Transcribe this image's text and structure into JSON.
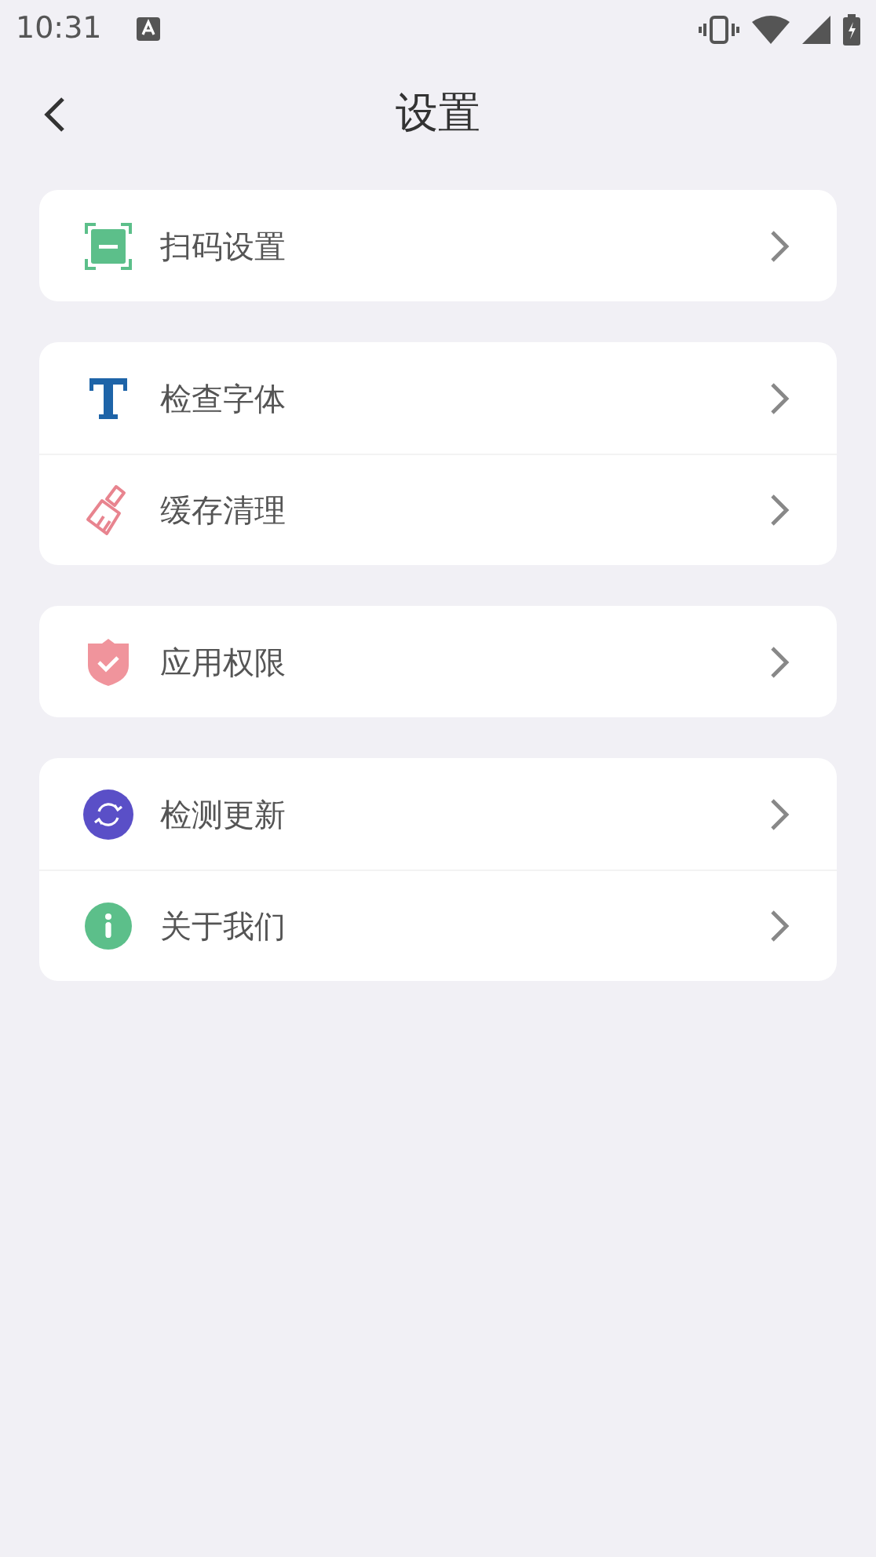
{
  "status_bar": {
    "time": "10:31"
  },
  "header": {
    "title": "设置"
  },
  "groups": [
    {
      "items": [
        {
          "kind": "scan",
          "label": "扫码设置"
        }
      ]
    },
    {
      "items": [
        {
          "kind": "font",
          "label": "检查字体"
        },
        {
          "kind": "clean",
          "label": "缓存清理"
        }
      ]
    },
    {
      "items": [
        {
          "kind": "permission",
          "label": "应用权限"
        }
      ]
    },
    {
      "items": [
        {
          "kind": "update",
          "label": "检测更新"
        },
        {
          "kind": "about",
          "label": "关于我们"
        }
      ]
    }
  ]
}
